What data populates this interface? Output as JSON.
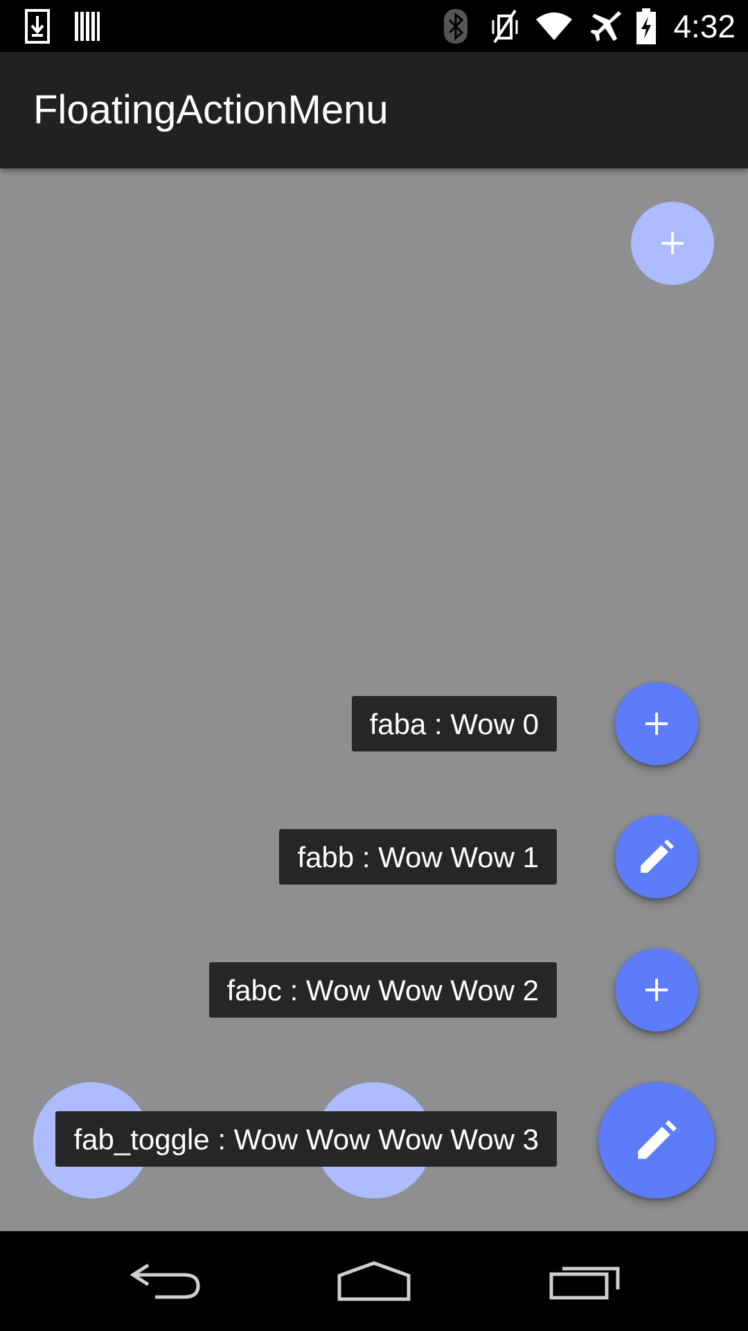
{
  "status_bar": {
    "time": "4:32",
    "icons": [
      "download-icon",
      "barcode-icon",
      "bluetooth-icon",
      "vibrate-off-icon",
      "wifi-icon",
      "airplane-icon",
      "battery-charging-icon"
    ]
  },
  "app_bar": {
    "title": "FloatingActionMenu"
  },
  "top_fab": {
    "icon": "plus-icon",
    "state": "faded"
  },
  "menu": {
    "items": [
      {
        "label": "faba : Wow 0",
        "icon": "plus-icon"
      },
      {
        "label": "fabb : Wow Wow 1",
        "icon": "pencil-icon"
      },
      {
        "label": "fabc : Wow Wow Wow 2",
        "icon": "plus-icon"
      },
      {
        "label": "fab_toggle : Wow Wow Wow Wow 3",
        "icon": "pencil-icon"
      }
    ]
  },
  "bottom_faded_fabs": [
    {
      "icon": "plus-icon"
    },
    {
      "icon": "pencil-icon"
    }
  ],
  "nav_bar": {
    "buttons": [
      "back-icon",
      "home-icon",
      "recents-icon"
    ]
  },
  "colors": {
    "fab_solid": "#5c7cfa",
    "fab_faded": "#adbcff",
    "label_bg": "#262626",
    "scrim": "#8e8f91",
    "app_bar": "#212121"
  }
}
